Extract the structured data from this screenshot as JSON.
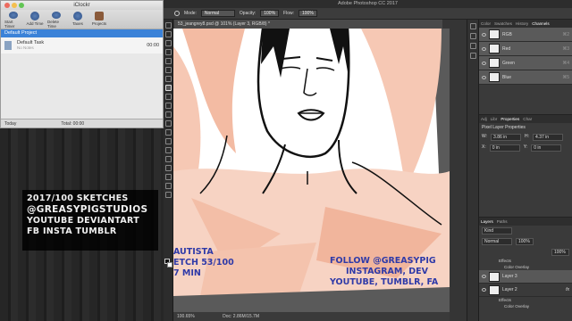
{
  "iclockr": {
    "title": "iClockr",
    "toolbar": [
      "Start Timer",
      "Add Time",
      "Delete Time",
      "Taxes",
      "Projects"
    ],
    "project": "Default Project",
    "task": {
      "name": "Default Task",
      "sub": "No Notes",
      "time": "00:00"
    },
    "footer": {
      "day": "Today",
      "total": "Total: 00:00"
    }
  },
  "overlay": {
    "line1": "2017/100 SKETCHES",
    "line2": "@GREASYPIGSTUDIOS",
    "line3": "YOUTUBE DEVIANTART",
    "line4": "FB INSTA TUMBLR"
  },
  "photoshop": {
    "title": "Adobe Photoshop CC 2017",
    "options": {
      "mode_label": "Mode:",
      "mode": "Normal",
      "opacity_label": "Opacity:",
      "opacity": "100%",
      "flow_label": "Flow:",
      "flow": "100%"
    },
    "doc_tab": "53_jeangrey8.psd @ 101% (Layer 3, RGB/8) *",
    "canvas_text": {
      "left1": "AUTISTA",
      "left2": "ETCH 53/100",
      "left3": "7   MIN",
      "right1": "FOLLOW @GREASYPIG",
      "right2": "INSTAGRAM, DEV",
      "right3": "YOUTUBE, TUMBLR, FA"
    },
    "status": {
      "zoom": "100.65%",
      "doc": "Doc: 2.86M/15.7M"
    },
    "channels_tabs": [
      "Color",
      "Swatches",
      "History",
      "Channels"
    ],
    "channels": [
      {
        "name": "RGB",
        "key": "⌘2"
      },
      {
        "name": "Red",
        "key": "⌘3"
      },
      {
        "name": "Green",
        "key": "⌘4"
      },
      {
        "name": "Blue",
        "key": "⌘5"
      }
    ],
    "props_tabs": [
      "Adj",
      "Libr",
      "Properties",
      "Char"
    ],
    "props": {
      "title": "Pixel Layer Properties",
      "w_label": "W:",
      "w": "3.86 in",
      "h_label": "H:",
      "h": "4.37 in",
      "x_label": "X:",
      "x": "0 in",
      "y_label": "Y:",
      "y": "0 in"
    },
    "layers_tabs": [
      "Layers",
      "Paths"
    ],
    "layers_kind": "Kind",
    "layers_mode": "Normal",
    "layers_opacity": "100%",
    "layers_fill": "100%",
    "layers": [
      {
        "label": "Effects",
        "kind": "fx"
      },
      {
        "label": "Color Overlay",
        "kind": "fx"
      },
      {
        "label": "Layer 3",
        "kind": "layer"
      },
      {
        "label": "Layer 2",
        "kind": "layer"
      },
      {
        "label": "Effects",
        "kind": "fx"
      },
      {
        "label": "Color Overlay",
        "kind": "fx"
      }
    ]
  }
}
